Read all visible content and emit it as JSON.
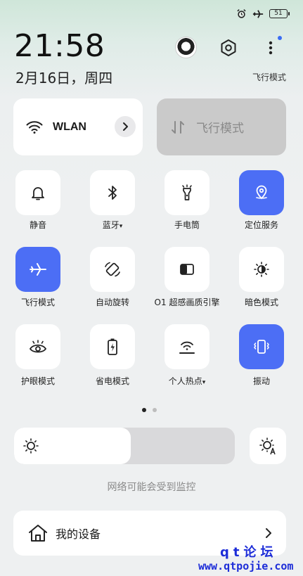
{
  "status_bar": {
    "battery": "51",
    "icons": [
      "alarm-icon",
      "airplane-icon",
      "battery-icon"
    ]
  },
  "header": {
    "time": "21:58",
    "date": "2月16日，周四",
    "mode_label": "飞行模式"
  },
  "big_tiles": {
    "wlan": {
      "label": "WLAN",
      "icon": "wifi-icon"
    },
    "airplane": {
      "label": "飞行模式",
      "icon": "data-arrows-icon"
    }
  },
  "tiles": [
    {
      "label": "静音",
      "icon": "bell-icon",
      "active": false
    },
    {
      "label": "蓝牙",
      "icon": "bluetooth-icon",
      "active": false,
      "dropdown": "▾"
    },
    {
      "label": "手电筒",
      "icon": "flashlight-icon",
      "active": false
    },
    {
      "label": "定位服务",
      "icon": "location-icon",
      "active": true
    },
    {
      "label": "飞行模式",
      "icon": "airplane-icon",
      "active": true
    },
    {
      "label": "自动旋转",
      "icon": "rotate-icon",
      "active": false
    },
    {
      "label": "O1 超感画质引擎",
      "icon": "display-icon",
      "active": false
    },
    {
      "label": "暗色模式",
      "icon": "dark-mode-icon",
      "active": false
    },
    {
      "label": "护眼模式",
      "icon": "eye-icon",
      "active": false
    },
    {
      "label": "省电模式",
      "icon": "battery-saver-icon",
      "active": false
    },
    {
      "label": "个人热点",
      "icon": "hotspot-icon",
      "active": false,
      "dropdown": "▾"
    },
    {
      "label": "振动",
      "icon": "vibrate-icon",
      "active": true
    }
  ],
  "pager": {
    "current": 1,
    "total": 2
  },
  "brightness": {
    "level": 0.53
  },
  "monitor_notice": "网络可能会受到监控",
  "device_card": {
    "label": "我的设备"
  },
  "watermark": {
    "line1": "qt论坛",
    "line2": "www.qtpojie.com"
  },
  "colors": {
    "accent": "#4c6ef5",
    "watermark": "#1d2dd8"
  }
}
